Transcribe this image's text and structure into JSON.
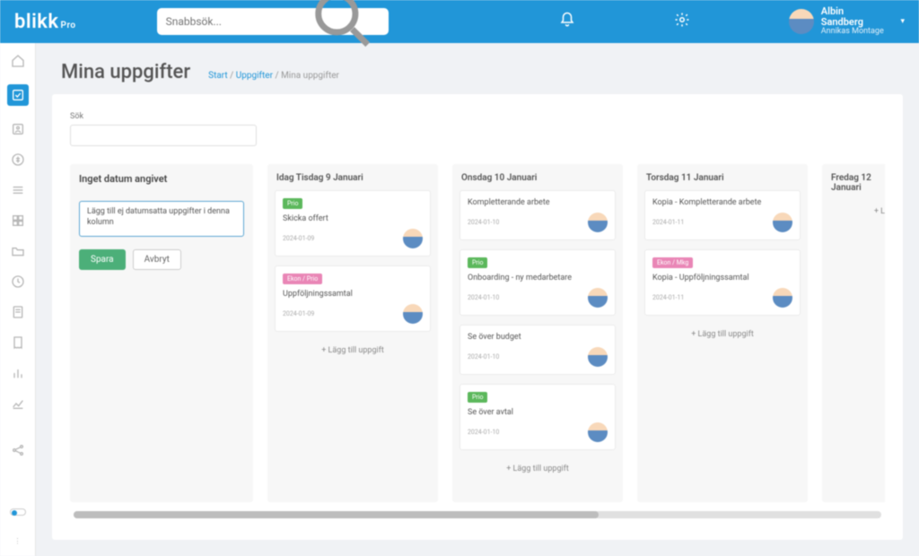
{
  "logo": {
    "main": "blikk",
    "sub": "Pro"
  },
  "search": {
    "placeholder": "Snabbsök..."
  },
  "user": {
    "name": "Albin Sandberg",
    "sub": "Annikas Montage"
  },
  "page": {
    "title": "Mina uppgifter",
    "crumbs": {
      "a": "Start",
      "b": "Uppgifter",
      "c": "Mina uppgifter"
    }
  },
  "sok": {
    "label": "Sök"
  },
  "new_col": {
    "header": "Inget datum angivet",
    "input_value": "Lägg till ej datumsatta uppgifter i denna kolumn",
    "save": "Spara",
    "cancel": "Avbryt"
  },
  "tags": {
    "prio": "Prio",
    "ekon_prio": "Ekon / Prio",
    "ekon_mkt": "Ekon / Mkg"
  },
  "add_label": "+ Lägg till uppgift",
  "add_short": "+ L",
  "columns": [
    {
      "header": "Idag Tisdag 9 Januari",
      "cards": [
        {
          "tag": "prio",
          "tag_class": "green",
          "title": "Skicka offert",
          "date": "2024-01-09"
        },
        {
          "tag": "ekon_prio",
          "tag_class": "pink",
          "title": "Uppföljningssamtal",
          "date": "2024-01-09"
        }
      ]
    },
    {
      "header": "Onsdag 10 Januari",
      "cards": [
        {
          "tag": "",
          "tag_class": "",
          "title": "Kompletterande arbete",
          "date": "2024-01-10"
        },
        {
          "tag": "prio",
          "tag_class": "green",
          "title": "Onboarding - ny medarbetare",
          "date": "2024-01-10"
        },
        {
          "tag": "",
          "tag_class": "",
          "title": "Se över budget",
          "date": "2024-01-10"
        },
        {
          "tag": "prio",
          "tag_class": "green",
          "title": "Se över avtal",
          "date": "2024-01-10"
        }
      ]
    },
    {
      "header": "Torsdag 11 Januari",
      "cards": [
        {
          "tag": "",
          "tag_class": "",
          "title": "Kopia - Kompletterande arbete",
          "date": "2024-01-11"
        },
        {
          "tag": "ekon_mkt",
          "tag_class": "pink",
          "title": "Kopia - Uppföljningssamtal",
          "date": "2024-01-11"
        }
      ]
    },
    {
      "header": "Fredag 12 Januari",
      "cards": []
    }
  ]
}
